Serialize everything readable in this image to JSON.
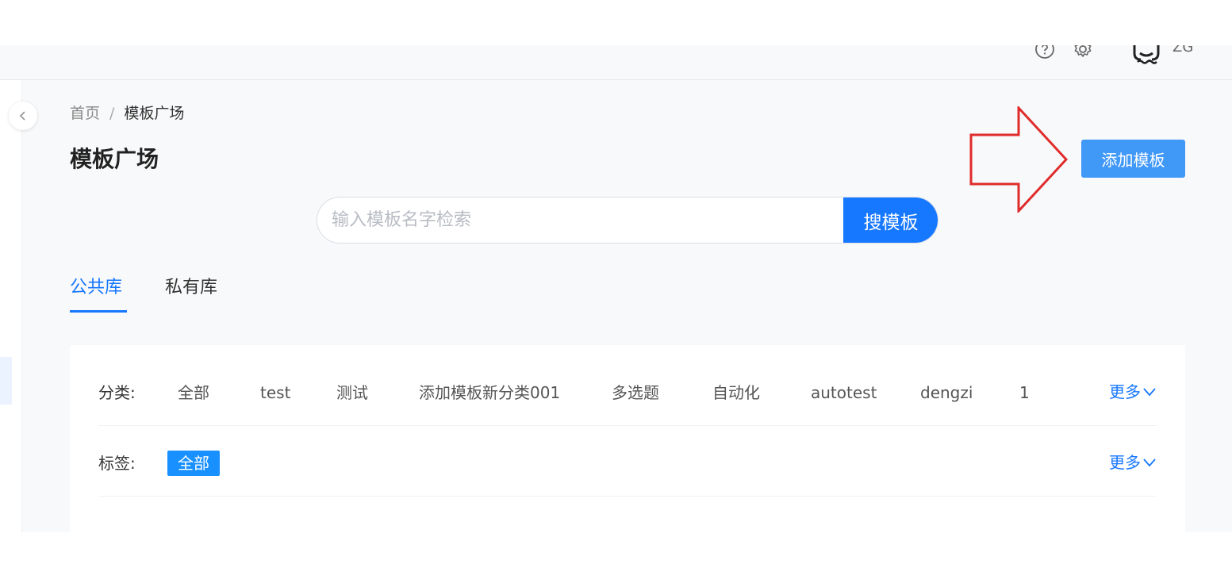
{
  "header": {
    "user_name": "ZG",
    "icons": [
      "help-icon",
      "gear-icon",
      "avatar"
    ]
  },
  "breadcrumb": {
    "home": "首页",
    "separator": "/",
    "current": "模板广场"
  },
  "page": {
    "title": "模板广场",
    "add_button": "添加模板"
  },
  "search": {
    "placeholder": "输入模板名字检索",
    "value": "",
    "button": "搜模板"
  },
  "tabs": [
    {
      "label": "公共库",
      "active": true
    },
    {
      "label": "私有库",
      "active": false
    }
  ],
  "filters": {
    "category": {
      "label": "分类:",
      "items": [
        "全部",
        "test",
        "测试",
        "添加模板新分类001",
        "多选题",
        "自动化",
        "autotest",
        "dengzi",
        "1"
      ],
      "more": "更多"
    },
    "tag": {
      "label": "标签:",
      "items": [
        "全部"
      ],
      "more": "更多"
    }
  },
  "colors": {
    "primary": "#1677ff",
    "add_button": "#4098f7",
    "annotation_arrow": "#e02b2b"
  }
}
